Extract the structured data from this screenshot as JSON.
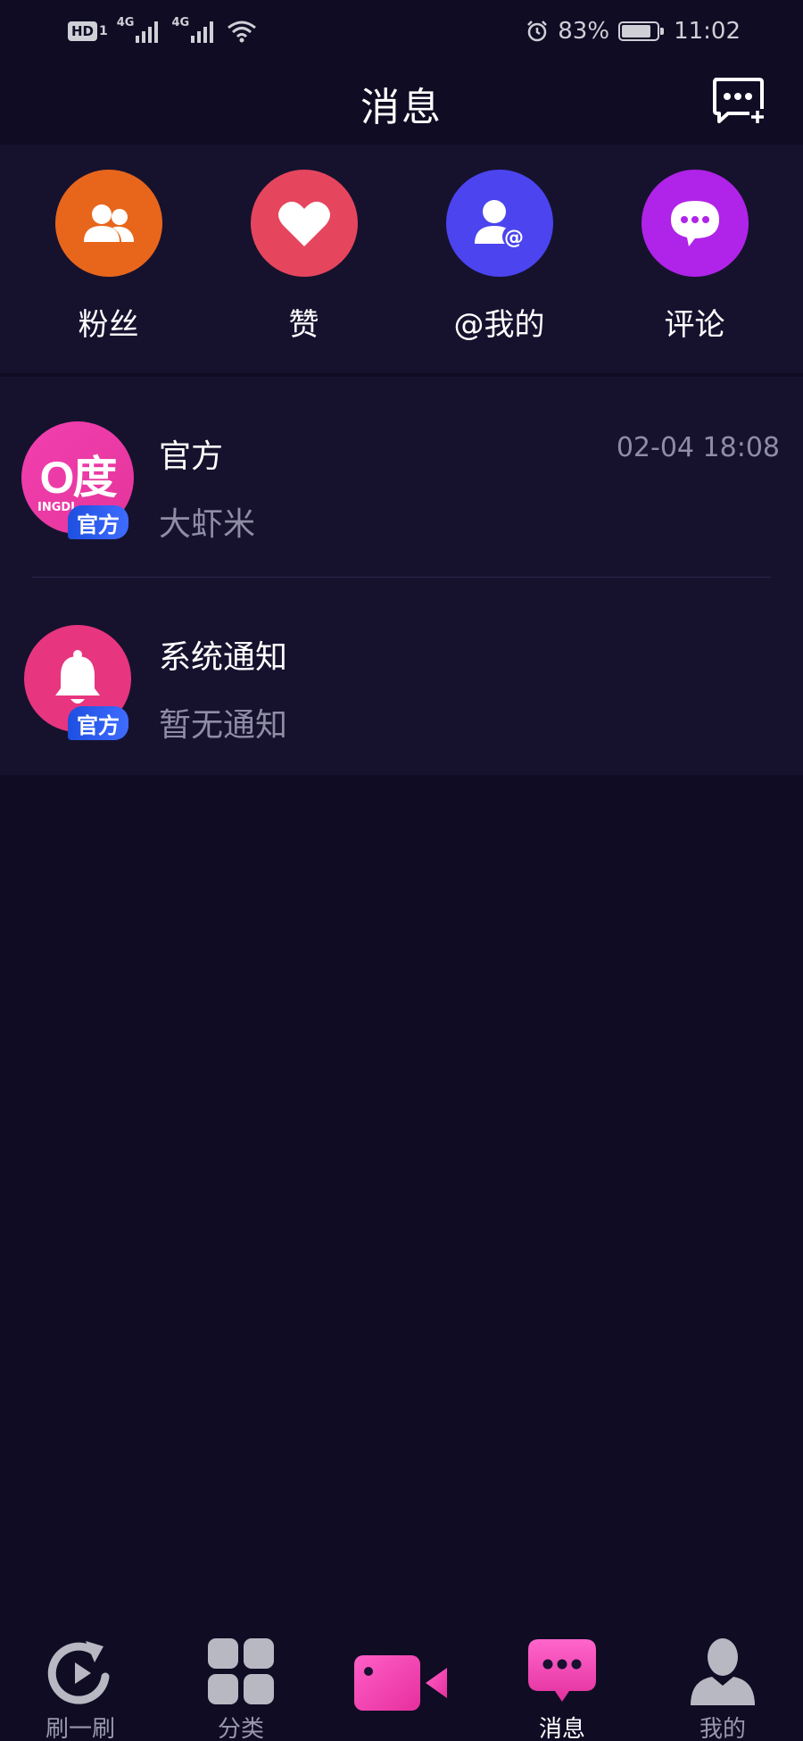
{
  "status_bar": {
    "hd": "HD",
    "sim": "1",
    "net1": "4G",
    "net2": "4G",
    "battery": "83%",
    "battery_level": 0.83,
    "time": "11:02"
  },
  "header": {
    "title": "消息"
  },
  "shortcuts": [
    {
      "label": "粉丝",
      "icon": "fans-icon",
      "color": "#e8661c"
    },
    {
      "label": "赞",
      "icon": "heart-icon",
      "color": "#e6455e"
    },
    {
      "label": "@我的",
      "icon": "mention-icon",
      "color": "#4b44ef"
    },
    {
      "label": "评论",
      "icon": "comment-icon",
      "color": "#b023e8"
    }
  ],
  "conversations": [
    {
      "name": "官方",
      "preview": "大虾米",
      "time": "02-04 18:08",
      "badge": "官方",
      "avatar_text": "O度",
      "avatar_subtext": "INGDI"
    },
    {
      "name": "系统通知",
      "preview": "暂无通知",
      "badge": "官方"
    }
  ],
  "bottom_nav": [
    {
      "label": "刷一刷",
      "icon": "refresh-icon"
    },
    {
      "label": "分类",
      "icon": "grid-icon"
    },
    {
      "label": "",
      "icon": "video-camera-icon"
    },
    {
      "label": "消息",
      "icon": "message-icon",
      "active": true
    },
    {
      "label": "我的",
      "icon": "profile-icon"
    }
  ],
  "colors": {
    "background": "#0f0c24",
    "panel": "#16122e",
    "accent_pink": "#f23fb0",
    "badge_blue": "#2f5cf0"
  }
}
